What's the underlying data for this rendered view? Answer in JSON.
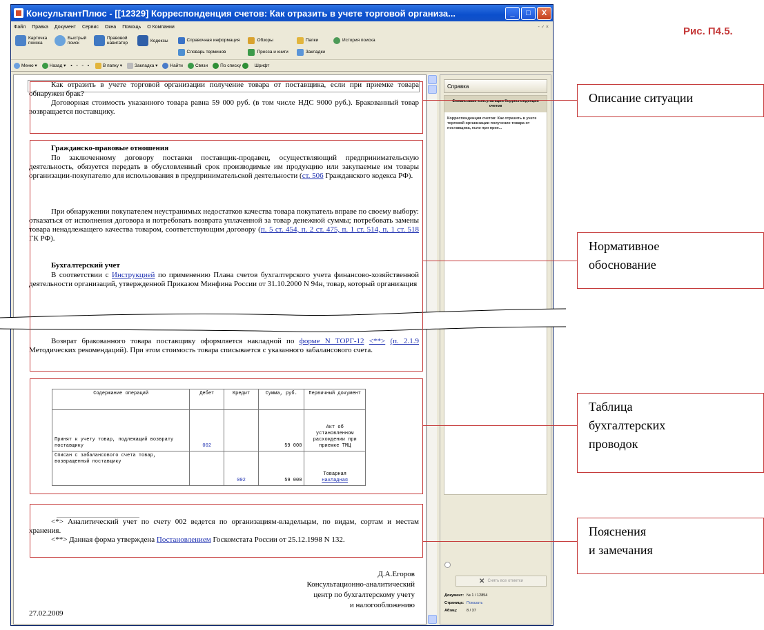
{
  "figure_caption": "Рис. П4.5.",
  "window": {
    "title": "КонсультантПлюс - [[12329] Корреспонденция счетов: Как отразить в учете торговой организа...",
    "buttons": [
      "_",
      "□",
      "X"
    ]
  },
  "menubar": {
    "items": [
      "Файл",
      "Правка",
      "Документ",
      "Сервис",
      "Окна",
      "Помощь",
      "О Компании"
    ],
    "mdi_controls": "- ♂ ×"
  },
  "toolbar": {
    "big_buttons": [
      {
        "label": "Карточка поиска",
        "icon": "search-card-icon",
        "color": "#4c83c9"
      },
      {
        "label": "Быстрый поиск",
        "icon": "quick-search-icon",
        "color": "#6aa3dc"
      },
      {
        "label": "Правовой навигатор",
        "icon": "navigator-icon",
        "color": "#3f78c2"
      },
      {
        "label": "Кодексы",
        "icon": "codex-icon",
        "color": "#2f5fa8"
      }
    ],
    "small_col1": [
      {
        "label": "Справочная информация",
        "color": "#3a73c7"
      },
      {
        "label": "Словарь терминов",
        "color": "#4d8fd1"
      }
    ],
    "small_col2": [
      {
        "label": "Обзоры",
        "color": "#d9a22e"
      },
      {
        "label": "Пресса и книги",
        "color": "#3c9a4a"
      }
    ],
    "small_col3": [
      {
        "label": "Папки",
        "color": "#e2b53c"
      },
      {
        "label": "Закладки",
        "color": "#5b95d8"
      }
    ],
    "small_col4": [
      {
        "label": "История поиска",
        "color": "#4c9a57"
      }
    ]
  },
  "toolbar2": {
    "items": [
      "Меню",
      "Назад",
      "В папку",
      "Закладка",
      "Найти",
      "Связи",
      "По списку",
      "Шрифт"
    ]
  },
  "document": {
    "situation": {
      "line1": "Как отразить в учете торговой организации получение товара от поставщика, если при приемке товара обнаружен брак?",
      "line2": "Договорная стоимость указанного товара равна 59 000 руб. (в том числе НДС 9000 руб.). Бракованный товар возвращается поставщику."
    },
    "civil": {
      "heading": "Гражданско-правовые отношения",
      "p1_pre": "По заключенному договору поставки поставщик-продавец, осуществляющий предпринимательскую деятельность, обязуется передать в обусловленный срок производимые им продукцию или закупаемые им товары организации-покупателю для использования в предпринимательской деятельности (",
      "p1_link": "ст. 506",
      "p1_post": " Гражданского кодекса РФ).",
      "p2_pre": "При обнаружении покупателем неустранимых недостатков качества товара покупатель вправе по своему выбору: отказаться от исполнения договора и потребовать возврата уплаченной за товар денежной суммы; потребовать замены товара ненадлежащего качества товаром, соответствующим договору (",
      "p2_links": "п. 5 ст. 454, п. 2 ст. 475, п. 1 ст. 514, п. 1 ст. 518",
      "p2_post": " ГК РФ)."
    },
    "accounting": {
      "heading": "Бухгалтерский учет",
      "p_pre": "В соответствии с ",
      "p_link": "Инструкцией",
      "p_post": " по применению Плана счетов бухгалтерского учета финансово-хозяйственной деятельности организаций, утвержденной Приказом Минфина России от 31.10.2000 N 94н, товар, который организация",
      "cont_pre": "Возврат бракованного товара поставщику оформляется накладной по ",
      "cont_link1": "форме N ТОРГ-12",
      "cont_link2": "<**>",
      "cont_link3": "(п. 2.1.9",
      "cont_post": " Методических рекомендаций). При этом стоимость товара списывается с указанного забалансового счета."
    },
    "table": {
      "headers": [
        "Содержание операций",
        "Дебет",
        "Кредит",
        "Сумма, руб.",
        "Первичный документ"
      ],
      "rows": [
        {
          "op": "Принят к учету товар, подлежащий возврату поставщику",
          "debit": "002",
          "credit": "",
          "sum": "59 000",
          "doc": "Акт об установленном расхождении при приемке ТМЦ"
        },
        {
          "op": "Списан с забалансового счета товар, возвращенный поставщику",
          "debit": "",
          "credit": "002",
          "sum": "59 000",
          "doc_pre": "Товарная",
          "doc_link": "накладная"
        }
      ]
    },
    "notes": {
      "n1": "<*> Аналитический учет по счету 002 ведется по организациям-владельцам, по видам, сортам и местам хранения.",
      "n2_pre": "<**> Данная форма утверждена ",
      "n2_link": "Постановлением",
      "n2_post": " Госкомстата России от 25.12.1998 N 132."
    },
    "signature": {
      "name": "Д.А.Егоров",
      "org1": "Консультационно-аналитический",
      "org2": "центр по бухгалтерскому учету",
      "org3": "и налогообложению"
    },
    "date": "27.02.2009"
  },
  "right_panel": {
    "tab": "Справка",
    "head": "Финансовые консультации Корреспонденция счетов",
    "text": "Корреспонденция счетов: Как отразить в учете торговой организации получение товара от поставщика, если при прие...",
    "close_button": "Снять все отметки",
    "info": [
      {
        "key": "Документ:",
        "value": "№ 1 / 12854"
      },
      {
        "key": "Страница:",
        "value": "Показать"
      },
      {
        "key": "Абзац:",
        "value": "8 / 37"
      }
    ]
  },
  "annotations": {
    "situation": "Описание ситуации",
    "normative_1": "Нормативное",
    "normative_2": "обоснование",
    "table_1": "Таблица",
    "table_2": "бухгалтерских",
    "table_3": "проводок",
    "notes_1": "Пояснения",
    "notes_2": "и замечания"
  }
}
